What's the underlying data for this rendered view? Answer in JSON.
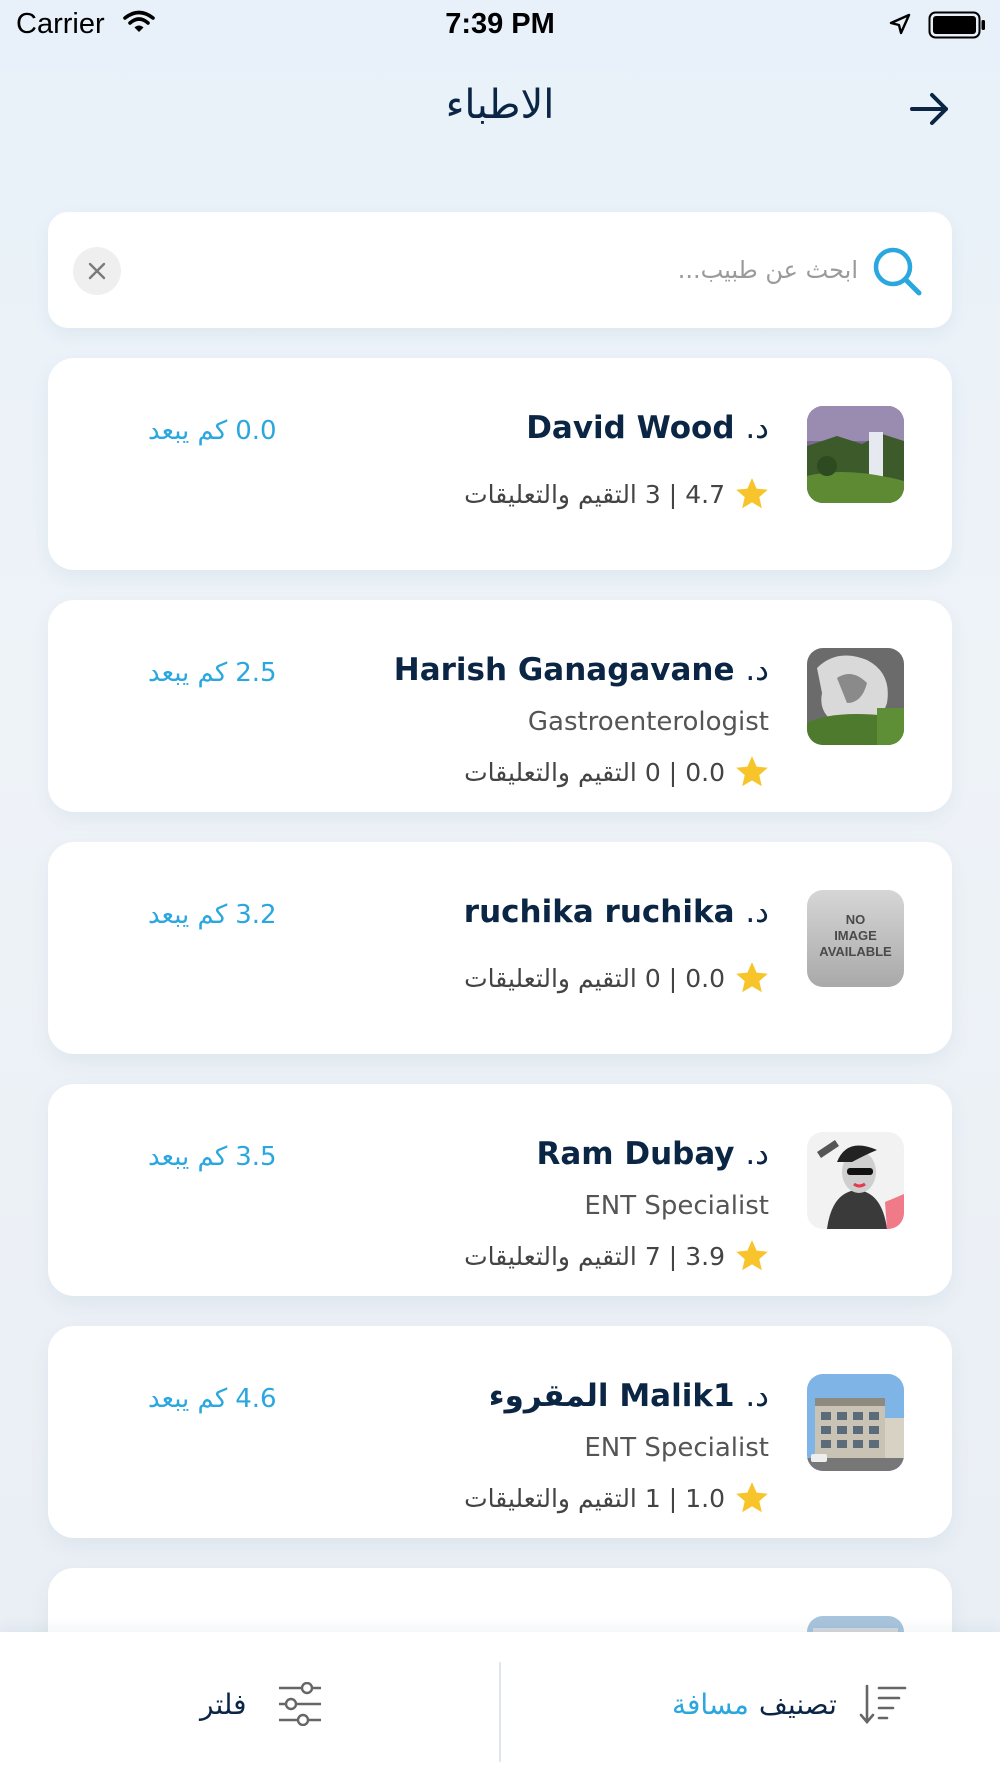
{
  "status_bar": {
    "carrier": "Carrier",
    "time": "7:39 PM"
  },
  "header": {
    "title": "الاطباء",
    "back_icon": "arrow-right-icon"
  },
  "search": {
    "placeholder": "ابحث عن طبيب...",
    "value": ""
  },
  "doctors": [
    {
      "prefix": "د.",
      "name": "David Wood",
      "specialty": "",
      "rating": "4.7",
      "reviews": "3",
      "reviews_label": "التقيم والتعليقات",
      "distance": "0.0",
      "distance_label": "كم يبعد",
      "image": "waterfall-photo"
    },
    {
      "prefix": "د.",
      "name": "Harish Ganagavane",
      "specialty": "Gastroenterologist",
      "rating": "0.0",
      "reviews": "0",
      "reviews_label": "التقيم والتعليقات",
      "distance": "2.5",
      "distance_label": "كم يبعد",
      "image": "sculpture-photo"
    },
    {
      "prefix": "د.",
      "name": "ruchika ruchika",
      "specialty": "",
      "rating": "0.0",
      "reviews": "0",
      "reviews_label": "التقيم والتعليقات",
      "distance": "3.2",
      "distance_label": "كم يبعد",
      "image": "no-image-available",
      "no_image_text": [
        "NO",
        "IMAGE",
        "AVAILABLE"
      ]
    },
    {
      "prefix": "د.",
      "name": "Ram Dubay",
      "specialty": "ENT Specialist",
      "rating": "3.9",
      "reviews": "7",
      "reviews_label": "التقيم والتعليقات",
      "distance": "3.5",
      "distance_label": "كم يبعد",
      "image": "portrait-photo"
    },
    {
      "prefix": "د.",
      "name": "Malik1 المقروء",
      "specialty": "ENT Specialist",
      "rating": "1.0",
      "reviews": "1",
      "reviews_label": "التقيم والتعليقات",
      "distance": "4.6",
      "distance_label": "كم يبعد",
      "image": "building-photo"
    }
  ],
  "bottom_bar": {
    "filter_label": "فلتر",
    "sort_label": "تصنيف",
    "sort_value": "مسافة"
  },
  "colors": {
    "accent": "#2aa7df",
    "title": "#0b2545",
    "star": "#f7c52b"
  }
}
